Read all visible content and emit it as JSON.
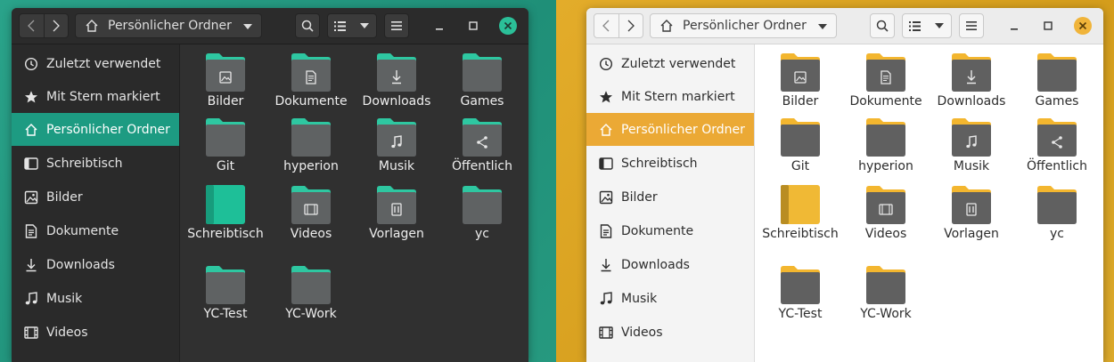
{
  "toolbar": {
    "location": "Persönlicher Ordner"
  },
  "sidebar": {
    "items": [
      {
        "label": "Zuletzt verwendet",
        "icon": "clock-icon"
      },
      {
        "label": "Mit Stern markiert",
        "icon": "star-icon"
      },
      {
        "label": "Persönlicher Ordner",
        "icon": "home-icon",
        "active": true
      },
      {
        "label": "Schreibtisch",
        "icon": "desktop-icon"
      },
      {
        "label": "Bilder",
        "icon": "image-icon"
      },
      {
        "label": "Dokumente",
        "icon": "document-icon"
      },
      {
        "label": "Downloads",
        "icon": "download-icon"
      },
      {
        "label": "Musik",
        "icon": "music-icon"
      },
      {
        "label": "Videos",
        "icon": "video-icon"
      }
    ]
  },
  "files": [
    {
      "label": "Bilder",
      "emblem": "image"
    },
    {
      "label": "Dokumente",
      "emblem": "document"
    },
    {
      "label": "Downloads",
      "emblem": "download"
    },
    {
      "label": "Games",
      "emblem": ""
    },
    {
      "label": "Git",
      "emblem": ""
    },
    {
      "label": "hyperion",
      "emblem": ""
    },
    {
      "label": "Musik",
      "emblem": "music"
    },
    {
      "label": "Öffentlich",
      "emblem": "share"
    },
    {
      "label": "Schreibtisch",
      "emblem": "desktop"
    },
    {
      "label": "Videos",
      "emblem": "video"
    },
    {
      "label": "Vorlagen",
      "emblem": "template"
    },
    {
      "label": "yc",
      "emblem": ""
    },
    {
      "label": "YC-Test",
      "emblem": ""
    },
    {
      "label": "YC-Work",
      "emblem": ""
    }
  ],
  "themes": {
    "dark": {
      "accent": "#1d9b82",
      "folder_tab": "#2ec7a1",
      "folder_body": "#5f6263"
    },
    "light": {
      "accent": "#eba935",
      "folder_tab": "#f3b62f",
      "folder_body": "#606060"
    }
  }
}
